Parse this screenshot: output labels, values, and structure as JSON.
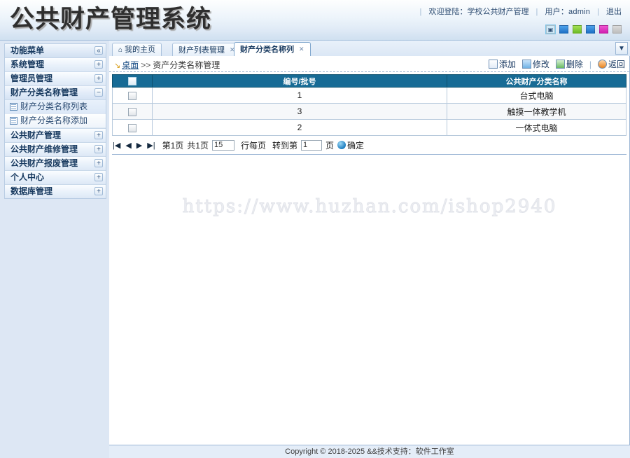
{
  "app": {
    "title": "公共财产管理系统",
    "accent": "#176b95",
    "sidebar_bg": "#dde7f4"
  },
  "header": {
    "welcome": "欢迎登陆：学校公共财产管理",
    "user_label": "用户：admin",
    "logout": "退出",
    "skins": [
      {
        "name": "skin-default",
        "color": "#cfe9f7",
        "glyph": "▣",
        "selected": true
      },
      {
        "name": "skin-blue",
        "color": "#2a7fd4",
        "glyph": "",
        "selected": false
      },
      {
        "name": "skin-green",
        "color": "#7ec832",
        "glyph": "",
        "selected": false
      },
      {
        "name": "skin-steel",
        "color": "#2a7fd4",
        "glyph": "",
        "selected": false
      },
      {
        "name": "skin-pink",
        "color": "#e030c0",
        "glyph": "",
        "selected": false
      },
      {
        "name": "skin-gray",
        "color": "#c9c9c9",
        "glyph": "",
        "selected": false
      }
    ]
  },
  "sidebar": {
    "menu_title": "功能菜单",
    "collapse_glyph": "«",
    "items": [
      {
        "label": "系统管理",
        "toggle": "+",
        "expanded": false
      },
      {
        "label": "管理员管理",
        "toggle": "+",
        "expanded": false
      },
      {
        "label": "财产分类名称管理",
        "toggle": "−",
        "expanded": true,
        "children": [
          {
            "label": "财产分类名称列表",
            "active": true
          },
          {
            "label": "财产分类名称添加",
            "active": false
          }
        ]
      },
      {
        "label": "公共财产管理",
        "toggle": "+",
        "expanded": false
      },
      {
        "label": "公共财产维修管理",
        "toggle": "+",
        "expanded": false
      },
      {
        "label": "公共财产报废管理",
        "toggle": "+",
        "expanded": false
      },
      {
        "label": "个人中心",
        "toggle": "+",
        "expanded": false
      },
      {
        "label": "数据库管理",
        "toggle": "+",
        "expanded": false
      }
    ]
  },
  "tabs": {
    "items": [
      {
        "label": "我的主页",
        "icon": "home-icon",
        "closable": false,
        "active": false
      },
      {
        "label": "财产列表管理",
        "icon": "",
        "closable": true,
        "active": false
      },
      {
        "label": "财产分类名称列",
        "icon": "",
        "closable": true,
        "active": true
      }
    ],
    "more_glyph": "▼",
    "close_glyph": "✕"
  },
  "breadcrumb": {
    "arrow_glyph": "↘",
    "home": "桌面",
    "separator": ">>",
    "current": "资产分类名称管理"
  },
  "toolbar": {
    "add_label": "添加",
    "edit_label": "修改",
    "delete_label": "删除",
    "back_label": "返回",
    "separator": "|"
  },
  "table": {
    "columns": [
      "",
      "编号/批号",
      "公共财产分类名称"
    ],
    "rows": [
      {
        "id": "1",
        "name": "台式电脑"
      },
      {
        "id": "3",
        "name": "触摸一体教学机"
      },
      {
        "id": "2",
        "name": "一体式电脑"
      }
    ]
  },
  "pager": {
    "first_glyph": "|◀",
    "prev_glyph": "◀",
    "next_glyph": "▶",
    "last_glyph": "▶|",
    "current_page_text": "第1页",
    "total_page_text": "共1页",
    "rows_per_page_value": "15",
    "rows_per_page_label": "行每页",
    "goto_label": "转到第",
    "goto_value": "1",
    "page_unit": "页",
    "confirm_label": "确定"
  },
  "watermark": "https://www.huzhan.com/ishop2940",
  "footer": "Copyright © 2018-2025 &&技术支持：软件工作室"
}
